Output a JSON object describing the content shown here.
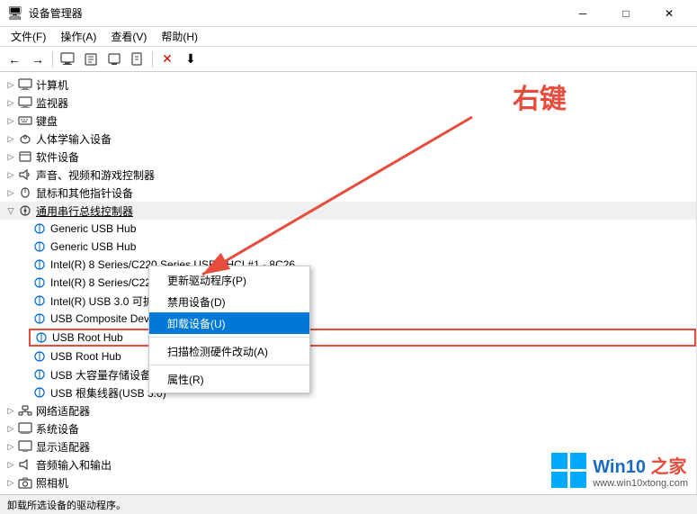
{
  "window": {
    "title": "设备管理器",
    "controls": {
      "minimize": "─",
      "maximize": "□",
      "close": "✕"
    }
  },
  "menubar": {
    "items": [
      "文件(F)",
      "操作(A)",
      "查看(V)",
      "帮助(H)"
    ]
  },
  "toolbar": {
    "buttons": [
      "←",
      "→",
      "🖥",
      "📋",
      "🖥",
      "📄",
      "✕",
      "⬇"
    ]
  },
  "tree": {
    "items": [
      {
        "label": "计算机",
        "icon": "🖥",
        "level": 0,
        "expand": "▷",
        "type": "node"
      },
      {
        "label": "监视器",
        "icon": "🖥",
        "level": 0,
        "expand": "▷",
        "type": "node"
      },
      {
        "label": "键盘",
        "icon": "⌨",
        "level": 0,
        "expand": "▷",
        "type": "node"
      },
      {
        "label": "人体学输入设备",
        "icon": "🖱",
        "level": 0,
        "expand": "▷",
        "type": "node"
      },
      {
        "label": "软件设备",
        "icon": "📦",
        "level": 0,
        "expand": "▷",
        "type": "node"
      },
      {
        "label": "声音、视频和游戏控制器",
        "icon": "🔊",
        "level": 0,
        "expand": "▷",
        "type": "node"
      },
      {
        "label": "鼠标和其他指针设备",
        "icon": "🖱",
        "level": 0,
        "expand": "▷",
        "type": "node"
      },
      {
        "label": "通用串行总线控制器",
        "icon": "🔌",
        "level": 0,
        "expand": "▽",
        "type": "open",
        "selected": false,
        "underline": true
      },
      {
        "label": "Generic USB Hub",
        "icon": "🔌",
        "level": 1,
        "expand": "",
        "type": "leaf"
      },
      {
        "label": "Generic USB Hub",
        "icon": "🔌",
        "level": 1,
        "expand": "",
        "type": "leaf"
      },
      {
        "label": "Intel(R) 8 Series/C220 Series USB EHCI #1 - 8C26",
        "icon": "🔌",
        "level": 1,
        "expand": "",
        "type": "leaf"
      },
      {
        "label": "Intel(R) 8 Series/C220 Series USB EHCI #2 - 8C2D",
        "icon": "🔌",
        "level": 1,
        "expand": "",
        "type": "leaf"
      },
      {
        "label": "Intel(R) USB 3.0 可扩展主机控制器 - 1.0 (Microsoft)",
        "icon": "🔌",
        "level": 1,
        "expand": "",
        "type": "leaf"
      },
      {
        "label": "USB Composite Device",
        "icon": "🔌",
        "level": 1,
        "expand": "",
        "type": "leaf"
      },
      {
        "label": "USB Root Hub",
        "icon": "🔌",
        "level": 1,
        "expand": "",
        "type": "leaf",
        "highlighted": true
      },
      {
        "label": "USB Root Hub",
        "icon": "🔌",
        "level": 1,
        "expand": "",
        "type": "leaf"
      },
      {
        "label": "USB 大容量存储设备",
        "icon": "🔌",
        "level": 1,
        "expand": "",
        "type": "leaf"
      },
      {
        "label": "USB 根集线器(USB 3.0)",
        "icon": "🔌",
        "level": 1,
        "expand": "",
        "type": "leaf"
      },
      {
        "label": "网络适配器",
        "icon": "🌐",
        "level": 0,
        "expand": "▷",
        "type": "node"
      },
      {
        "label": "系统设备",
        "icon": "💻",
        "level": 0,
        "expand": "▷",
        "type": "node"
      },
      {
        "label": "显示适配器",
        "icon": "🖥",
        "level": 0,
        "expand": "▷",
        "type": "node"
      },
      {
        "label": "音频输入和输出",
        "icon": "🔊",
        "level": 0,
        "expand": "▷",
        "type": "node"
      },
      {
        "label": "照相机",
        "icon": "📷",
        "level": 0,
        "expand": "▷",
        "type": "node"
      }
    ]
  },
  "contextMenu": {
    "items": [
      {
        "label": "更新驱动程序(P)",
        "type": "item"
      },
      {
        "label": "禁用设备(D)",
        "type": "item"
      },
      {
        "label": "卸载设备(U)",
        "type": "item",
        "active": true
      },
      {
        "type": "sep"
      },
      {
        "label": "扫描检测硬件改动(A)",
        "type": "item"
      },
      {
        "type": "sep"
      },
      {
        "label": "属性(R)",
        "type": "item"
      }
    ]
  },
  "annotation": {
    "text": "右键"
  },
  "statusBar": {
    "text": "卸载所选设备的驱动程序。"
  },
  "watermark": {
    "main": "Win10 之家",
    "sub": "www.win10xtong.com"
  }
}
